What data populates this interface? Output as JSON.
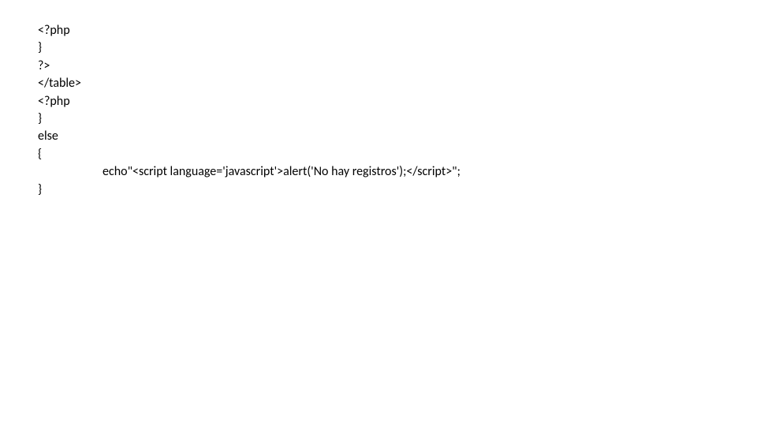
{
  "code": {
    "line1": "<?php",
    "line2": "}",
    "line3": "?>",
    "line4": "</table>",
    "line5": "<?php",
    "line6": "}",
    "line7": "else",
    "line8": "{",
    "line9": "echo\"<script language='javascript'>alert('No hay registros');</script>\";",
    "line10": "}"
  }
}
